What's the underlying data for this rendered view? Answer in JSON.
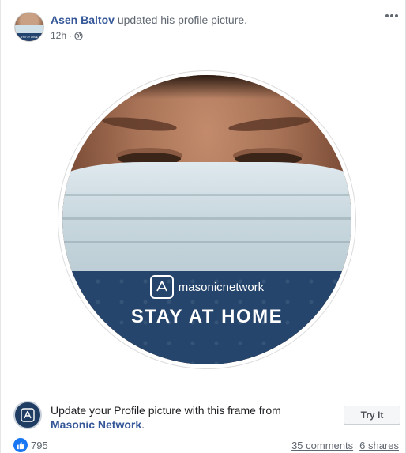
{
  "post": {
    "author": "Asen Baltov",
    "action": "updated his profile picture.",
    "time": "12h",
    "separator": "·",
    "audience_icon": "globe-icon",
    "more_icon": "more-dots-icon"
  },
  "avatar": {
    "band_text": "STAY AT HOME"
  },
  "photo": {
    "brand_name": "masonicnetwork",
    "banner_text": "STAY AT HOME"
  },
  "frame": {
    "prompt": "Update your Profile picture with this frame from",
    "source": "Masonic Network",
    "source_suffix": ".",
    "try_label": "Try It"
  },
  "stats": {
    "likes": "795",
    "comments": "35 comments",
    "shares": "6 shares"
  },
  "colors": {
    "link": "#365899",
    "banner": "#25456c",
    "like": "#1877f2"
  }
}
